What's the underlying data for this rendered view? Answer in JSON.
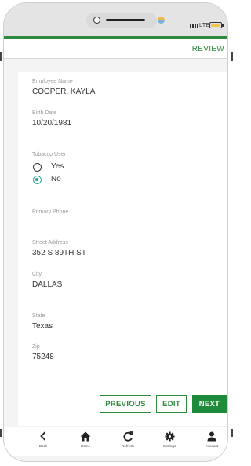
{
  "appbar": {
    "action_label": "REVIEW"
  },
  "status": {
    "network": "LTE"
  },
  "fields": [
    {
      "label": "Employee Name",
      "value": "COOPER, KAYLA"
    },
    {
      "label": "Birth Date",
      "value": "10/20/1981"
    },
    {
      "label": "Primary Phone",
      "value": ""
    },
    {
      "label": "Street Address",
      "value": "352 S 89TH ST"
    },
    {
      "label": "City",
      "value": "DALLAS"
    },
    {
      "label": "State",
      "value": "Texas"
    },
    {
      "label": "Zip",
      "value": "75248"
    }
  ],
  "tobacco": {
    "label": "Tobacco User",
    "options": [
      "Yes",
      "No"
    ],
    "selected": "No"
  },
  "buttons": {
    "previous": "PREVIOUS",
    "edit": "EDIT",
    "next": "NEXT"
  },
  "nav": {
    "items": [
      {
        "label": "Back",
        "icon": "chevron-left-icon"
      },
      {
        "label": "Home",
        "icon": "home-icon"
      },
      {
        "label": "Refresh",
        "icon": "refresh-icon"
      },
      {
        "label": "Settings",
        "icon": "gear-icon"
      },
      {
        "label": "Account",
        "icon": "person-icon"
      }
    ]
  },
  "colors": {
    "accent": "#2e8b3e",
    "radio_selected": "#26a69a"
  }
}
